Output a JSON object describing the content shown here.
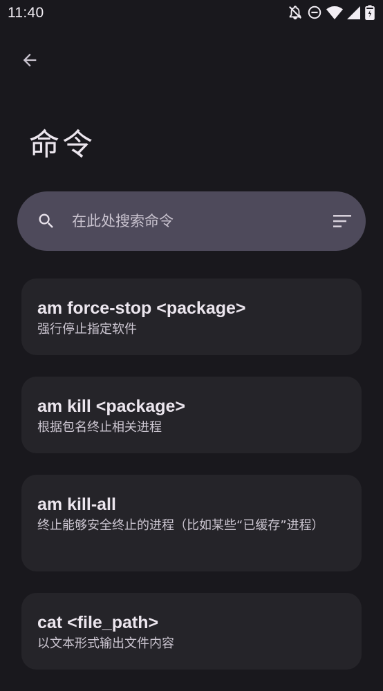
{
  "status_bar": {
    "time": "11:40",
    "icons": [
      "notifications-off-icon",
      "do-not-disturb-icon",
      "wifi-icon",
      "cellular-signal-icon",
      "battery-icon"
    ]
  },
  "header": {
    "title": "命令"
  },
  "search": {
    "placeholder": "在此处搜索命令"
  },
  "commands": [
    {
      "name": "am force-stop <package>",
      "description": "强行停止指定软件"
    },
    {
      "name": "am kill <package>",
      "description": "根据包名终止相关进程"
    },
    {
      "name": "am kill-all",
      "description": "终止能够安全终止的进程（比如某些“已缓存”进程）"
    },
    {
      "name": "cat <file_path>",
      "description": "以文本形式输出文件内容"
    }
  ],
  "colors": {
    "background": "#19181d",
    "card": "#252429",
    "search_bar": "#4e4a5b",
    "text_primary": "#ece6ee",
    "text_secondary": "#cdc7d2"
  }
}
